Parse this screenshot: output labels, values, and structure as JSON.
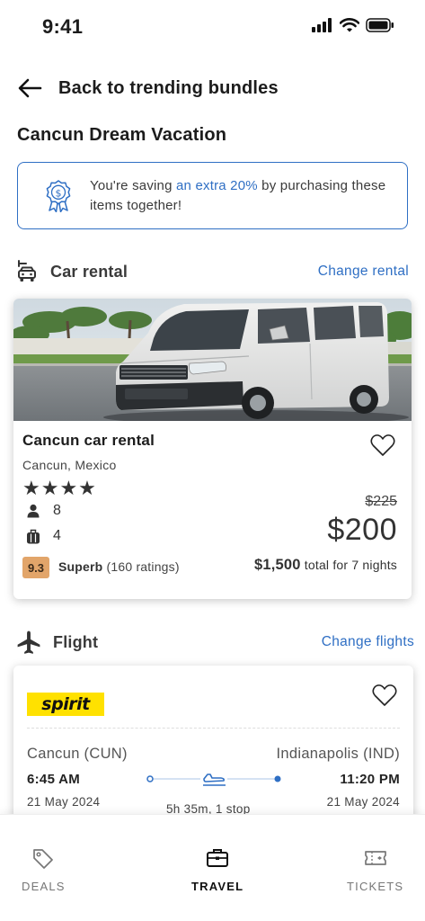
{
  "status_bar": {
    "time": "9:41"
  },
  "header": {
    "back_label": "Back to trending bundles"
  },
  "page_title": "Cancun Dream Vacation",
  "savings": {
    "prefix": "You're saving ",
    "accent": "an extra 20%",
    "suffix": " by purchasing these items together!"
  },
  "car_section": {
    "title": "Car rental",
    "link": "Change rental"
  },
  "car": {
    "name": "Cancun car rental",
    "location": "Cancun, Mexico",
    "stars": "★★★★",
    "star_rating": 4,
    "passengers": "8",
    "bags": "4",
    "old_price": "$225",
    "price": "$200",
    "rating_score": "9.3",
    "rating_label": "Superb",
    "rating_count": "(160 ratings)",
    "total_amount": "$1,500",
    "total_suffix": "total for 7 nights"
  },
  "flight_section": {
    "title": "Flight",
    "link": "Change flights"
  },
  "flight": {
    "airline": "spirit",
    "brand_color": "#FFE100",
    "origin": "Cancun (CUN)",
    "destination": "Indianapolis (IND)",
    "depart_time": "6:45 AM",
    "arrive_time": "11:20 PM",
    "depart_date": "21 May 2024",
    "arrive_date": "21 May 2024",
    "duration": "5h 35m, 1 stop"
  },
  "nav": {
    "items": [
      {
        "label": "DEALS",
        "icon": "tag-icon",
        "active": false
      },
      {
        "label": "TRAVEL",
        "icon": "suitcase-icon",
        "active": true
      },
      {
        "label": "TICKETS",
        "icon": "ticket-icon",
        "active": false
      }
    ]
  },
  "colors": {
    "accent": "#2F6FC4",
    "rating_badge": "#E2A56A"
  }
}
